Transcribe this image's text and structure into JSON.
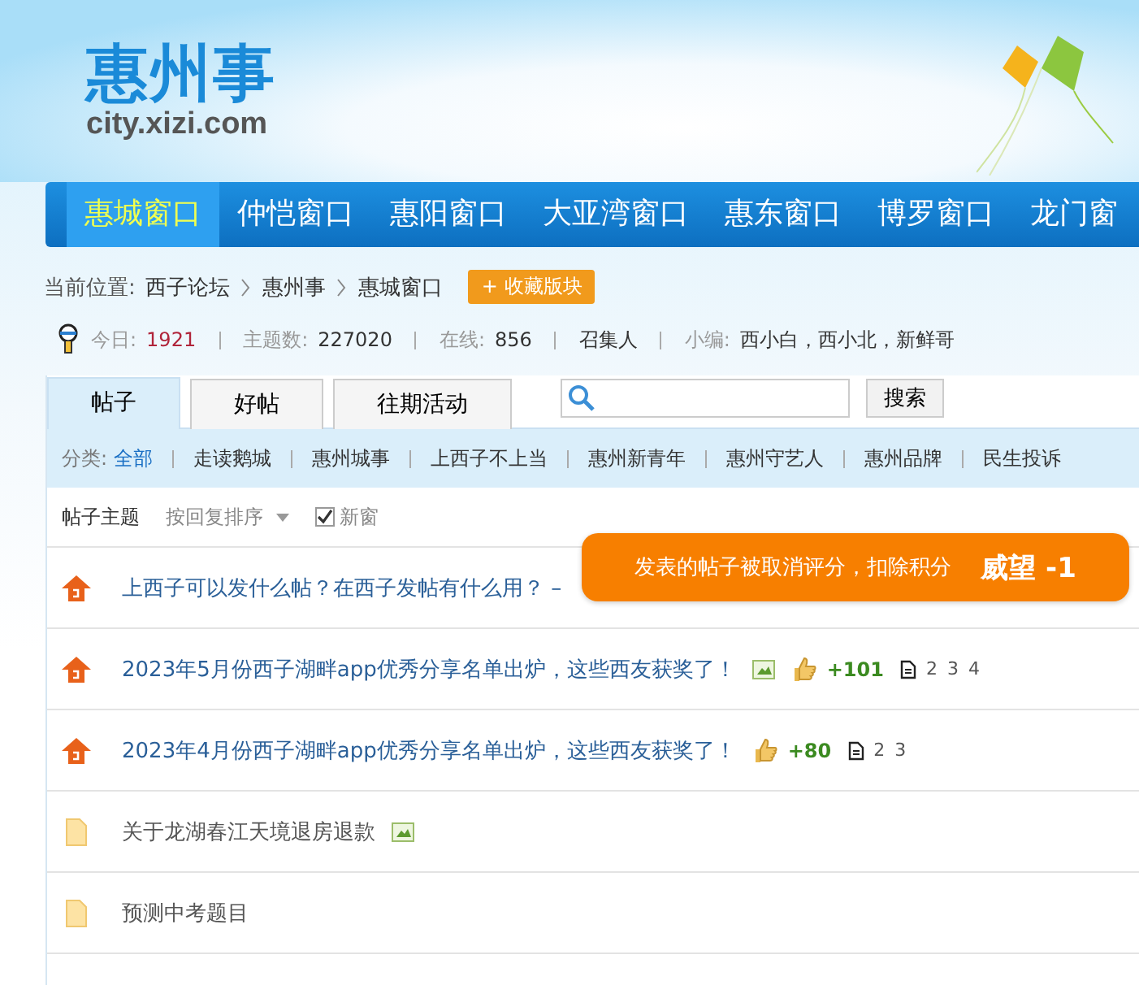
{
  "header": {
    "logo_title": "惠州事",
    "logo_domain": "city.xizi.com"
  },
  "nav": [
    {
      "label": "惠城窗口",
      "selected": true
    },
    {
      "label": "仲恺窗口",
      "selected": false
    },
    {
      "label": "惠阳窗口",
      "selected": false
    },
    {
      "label": "大亚湾窗口",
      "selected": false
    },
    {
      "label": "惠东窗口",
      "selected": false
    },
    {
      "label": "博罗窗口",
      "selected": false
    },
    {
      "label": "龙门窗",
      "selected": false
    }
  ],
  "breadcrumb": {
    "label": "当前位置:",
    "items": [
      "西子论坛",
      "惠州事",
      "惠城窗口"
    ],
    "favorite_button": "+ 收藏版块"
  },
  "stats": [
    {
      "label": "今日:",
      "value": "1921",
      "kind": "highlight"
    },
    {
      "label": "主题数:",
      "value": "227020",
      "kind": "plain"
    },
    {
      "label": "在线:",
      "value": "856",
      "kind": "plain"
    },
    {
      "value": "召集人",
      "kind": "plain"
    },
    {
      "label": "小编:",
      "value": "西小白，西小北，新鲜哥",
      "kind": "plain"
    }
  ],
  "tabs": [
    {
      "label": "帖子",
      "selected": true
    },
    {
      "label": "好帖",
      "selected": false
    },
    {
      "label": "往期活动",
      "selected": false
    }
  ],
  "search": {
    "button": "搜索"
  },
  "categories": {
    "label": "分类:",
    "items": [
      {
        "label": "全部",
        "selected": true
      },
      {
        "label": "走读鹅城",
        "selected": false
      },
      {
        "label": "惠州城事",
        "selected": false
      },
      {
        "label": "上西子不上当",
        "selected": false
      },
      {
        "label": "惠州新青年",
        "selected": false
      },
      {
        "label": "惠州守艺人",
        "selected": false
      },
      {
        "label": "惠州品牌",
        "selected": false
      },
      {
        "label": "民生投诉",
        "selected": false
      }
    ]
  },
  "toolbar": {
    "title": "帖子主题",
    "sort": "按回复排序",
    "new_window": {
      "label": "新窗",
      "checked": true
    }
  },
  "threads": [
    {
      "kind": "hot",
      "title": "上西子可以发什么帖？在西子发帖有什么用？ –",
      "has_image": false
    },
    {
      "kind": "hot",
      "title": "2023年5月份西子湖畔app优秀分享名单出炉，这些西友获奖了！",
      "has_image": true,
      "score": "+101",
      "pages": [
        "2",
        "3",
        "4"
      ]
    },
    {
      "kind": "hot",
      "title": "2023年4月份西子湖畔app优秀分享名单出炉，这些西友获奖了！",
      "has_image": false,
      "score": "+80",
      "pages": [
        "2",
        "3"
      ]
    },
    {
      "kind": "normal",
      "title": "关于龙湖春江天境退房退款",
      "has_image": true
    },
    {
      "kind": "normal",
      "title": "预测中考题目",
      "has_image": false
    }
  ],
  "toast": {
    "message": "发表的帖子被取消评分，扣除积分",
    "value": "威望 -1"
  }
}
